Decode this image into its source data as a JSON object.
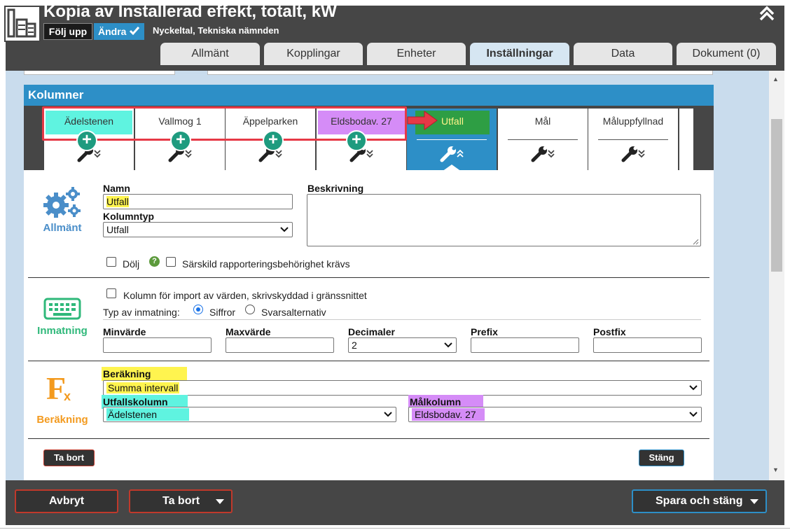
{
  "header": {
    "title": "Kopia av Installerad effekt, totalt, kW",
    "follow_label": "Följ upp",
    "edit_label": "Ändra",
    "subtitle": "Nyckeltal, Tekniska nämnden",
    "tabs": [
      {
        "label": "Allmänt",
        "active": false
      },
      {
        "label": "Kopplingar",
        "active": false
      },
      {
        "label": "Enheter",
        "active": false
      },
      {
        "label": "Inställningar",
        "active": true
      },
      {
        "label": "Data",
        "active": false
      },
      {
        "label": "Dokument (0)",
        "active": false
      }
    ]
  },
  "panel": {
    "title": "Kolumner",
    "columns": [
      {
        "label": "Ädelstenen",
        "highlight": "#5ff3e0"
      },
      {
        "label": "Vallmog 1",
        "highlight": ""
      },
      {
        "label": "Äppelparken",
        "highlight": ""
      },
      {
        "label": "Eldsbodav. 27",
        "highlight": "#d58cf7"
      },
      {
        "label": "Utfall",
        "highlight": "#2e9e44",
        "active": true
      },
      {
        "label": "Mål",
        "highlight": ""
      },
      {
        "label": "Måluppfyllnad",
        "highlight": ""
      }
    ],
    "general": {
      "section_label": "Allmänt",
      "name_label": "Namn",
      "name_value": "Utfall",
      "column_type_label": "Kolumntyp",
      "column_type_value": "Utfall",
      "description_label": "Beskrivning",
      "description_value": "",
      "hide_label": "Dölj",
      "hide_checked": false,
      "special_perm_label": "Särskild rapporteringsbehörighet krävs",
      "special_perm_checked": false
    },
    "input": {
      "section_label": "Inmatning",
      "import_label": "Kolumn för import av värden, skrivskyddad i gränssnittet",
      "import_checked": false,
      "input_type_label": "Typ av inmatning:",
      "option_numbers": "Siffror",
      "option_answers": "Svarsalternativ",
      "selected_option": "Siffror",
      "min_label": "Minvärde",
      "min_value": "",
      "max_label": "Maxvärde",
      "max_value": "",
      "decimals_label": "Decimaler",
      "decimals_value": "2",
      "prefix_label": "Prefix",
      "prefix_value": "",
      "postfix_label": "Postfix",
      "postfix_value": ""
    },
    "calculation": {
      "section_label": "Beräkning",
      "calc_label": "Beräkning",
      "calc_value": "Summa intervall",
      "outcome_col_label": "Utfallskolumn",
      "outcome_col_value": "Ädelstenen",
      "target_col_label": "Målkolumn",
      "target_col_value": "Eldsbodav. 27"
    },
    "remove_label": "Ta bort",
    "close_label": "Stäng"
  },
  "footer": {
    "cancel_label": "Avbryt",
    "remove_label": "Ta bort",
    "save_label": "Spara och stäng"
  },
  "colors": {
    "header_bg": "#464646",
    "accent_blue": "#2d8fc7",
    "main_bg": "#c9dced",
    "section_general": "#4a8ec9",
    "section_input": "#2fb87a",
    "section_calc": "#f39a1e",
    "highlight_red": "#e63946",
    "plus_badge": "#1e9b7f"
  }
}
